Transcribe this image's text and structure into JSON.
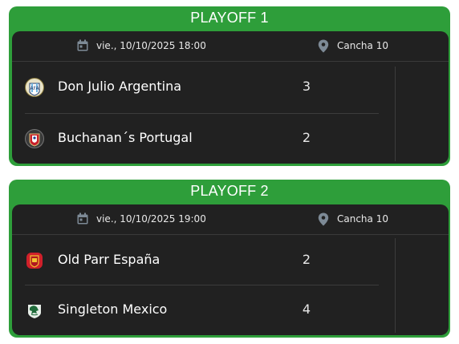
{
  "matches": [
    {
      "title": "PLAYOFF 1",
      "datetime": "vie., 10/10/2025 18:00",
      "venue": "Cancha 10",
      "teams": [
        {
          "name": "Don Julio Argentina",
          "score": "3",
          "icon": "argentina-crest-icon"
        },
        {
          "name": "Buchanan´s Portugal",
          "score": "2",
          "icon": "portugal-crest-icon"
        }
      ]
    },
    {
      "title": "PLAYOFF 2",
      "datetime": "vie., 10/10/2025 19:00",
      "venue": "Cancha 10",
      "teams": [
        {
          "name": "Old Parr España",
          "score": "2",
          "icon": "spain-crest-icon"
        },
        {
          "name": "Singleton Mexico",
          "score": "4",
          "icon": "mexico-crest-icon"
        }
      ]
    }
  ],
  "colors": {
    "accent": "#2e9e3a",
    "panel": "#212121",
    "icon": "#7d8a96"
  }
}
